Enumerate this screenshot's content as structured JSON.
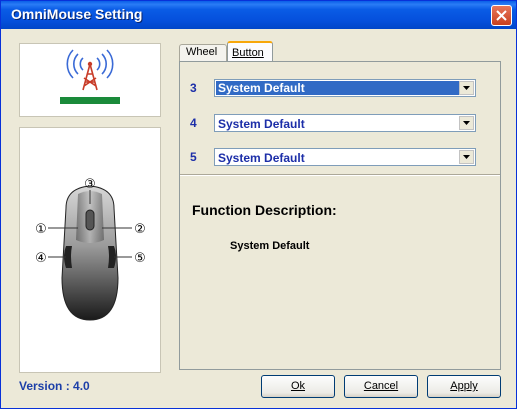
{
  "window": {
    "title": "OmniMouse Setting"
  },
  "left": {
    "version_text": "Version : 4.0"
  },
  "tabs": [
    {
      "label": "Wheel",
      "active": false
    },
    {
      "label": "Button",
      "active": true
    }
  ],
  "buttons": [
    {
      "number": "3",
      "value": "System Default",
      "selected": true
    },
    {
      "number": "4",
      "value": "System Default",
      "selected": false
    },
    {
      "number": "5",
      "value": "System Default",
      "selected": false
    }
  ],
  "function": {
    "title": "Function Description:",
    "description": "System Default"
  },
  "mouse_labels": [
    "①",
    "②",
    "③",
    "④",
    "⑤"
  ],
  "footer": {
    "ok_label": "Ok",
    "cancel_label": "Cancel",
    "apply_label": "Apply"
  },
  "colors": {
    "title_bar": "#0a5ce6",
    "selection": "#316ac5",
    "number": "#1c2ea8",
    "logo_bar": "#1a8a3a"
  },
  "icons": [
    "wireless-antenna-icon",
    "mouse-diagram",
    "close-icon",
    "dropdown-arrow-icon"
  ]
}
